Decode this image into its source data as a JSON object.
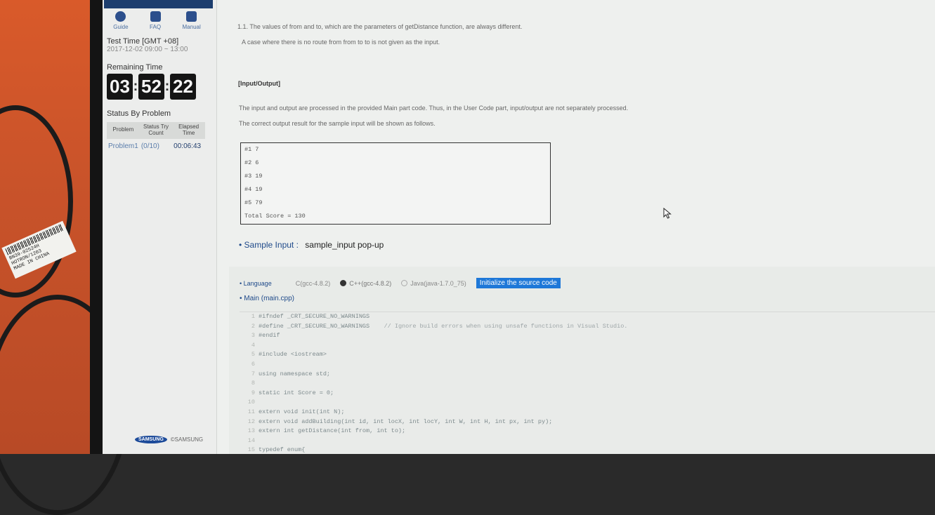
{
  "sidebar": {
    "nav": [
      {
        "label": "Guide",
        "icon": "help-icon"
      },
      {
        "label": "FAQ",
        "icon": "faq-icon"
      },
      {
        "label": "Manual",
        "icon": "manual-icon"
      }
    ],
    "test_time_label": "Test Time [GMT +08]",
    "test_time_value": "2017-12-02 09:00 ~ 13:00",
    "remaining_label": "Remaining Time",
    "remaining": {
      "h": "03",
      "m": "52",
      "s": "22"
    },
    "status_label": "Status By Problem",
    "table": {
      "headers": [
        "Problem",
        "Status Try Count",
        "Elapsed Time"
      ],
      "rows": [
        {
          "problem": "Problem1",
          "status": "(0/10)",
          "elapsed": "00:06:43"
        }
      ]
    },
    "logo_text": "SAMSUNG",
    "logo_text2": "©SAMSUNG"
  },
  "content": {
    "note_1": "1.1. The values of from and to, which are the parameters of getDistance function, are always different.",
    "note_2": "A case where there is no route from from to to is not given as the input.",
    "io_heading": "[Input/Output]",
    "io_1": "The input and output are processed in the provided Main part code. Thus, in the User Code part, input/output are not separately processed.",
    "io_2": "The correct output result for the sample input will be shown as follows.",
    "output_lines": [
      "#1 7",
      "#2 6",
      "#3 19",
      "#4 19",
      "#5 79",
      "Total Score = 130"
    ],
    "sample_label": "• Sample Input :",
    "sample_link": "sample_input pop-up"
  },
  "editor": {
    "language_label": "• Language",
    "languages": [
      {
        "label": "C(gcc-4.8.2)",
        "selected": false
      },
      {
        "label": "C++(gcc-4.8.2)",
        "selected": true
      },
      {
        "label": "Java(java-1.7.0_75)",
        "selected": false
      }
    ],
    "init_button": "Initialize the source code",
    "main_file": "• Main (main.cpp)",
    "code_lines": [
      {
        "n": "1",
        "t": "#ifndef _CRT_SECURE_NO_WARNINGS",
        "c": ""
      },
      {
        "n": "2",
        "t": "#define _CRT_SECURE_NO_WARNINGS",
        "c": "    // Ignore build errors when using unsafe functions in Visual Studio."
      },
      {
        "n": "3",
        "t": "#endif",
        "c": ""
      },
      {
        "n": "4",
        "t": "",
        "c": ""
      },
      {
        "n": "5",
        "t": "#include <iostream>",
        "c": ""
      },
      {
        "n": "6",
        "t": "",
        "c": ""
      },
      {
        "n": "7",
        "t": "using namespace std;",
        "c": ""
      },
      {
        "n": "8",
        "t": "",
        "c": ""
      },
      {
        "n": "9",
        "t": "static int Score = 0;",
        "c": ""
      },
      {
        "n": "10",
        "t": "",
        "c": ""
      },
      {
        "n": "11",
        "t": "extern void init(int N);",
        "c": ""
      },
      {
        "n": "12",
        "t": "extern void addBuilding(int id, int locX, int locY, int W, int H, int px, int py);",
        "c": ""
      },
      {
        "n": "13",
        "t": "extern int getDistance(int from, int to);",
        "c": ""
      },
      {
        "n": "14",
        "t": "",
        "c": ""
      },
      {
        "n": "15",
        "t": "typedef enum{",
        "c": ""
      }
    ]
  },
  "photo": {
    "tag_lines": [
      "BN39-02524H",
      "HOTRON/1203",
      "MADE IN CHINA"
    ]
  },
  "colors": {
    "accent": "#1f4a8a",
    "button": "#1e78d8",
    "sidebar_top": "#1d3e6e"
  }
}
